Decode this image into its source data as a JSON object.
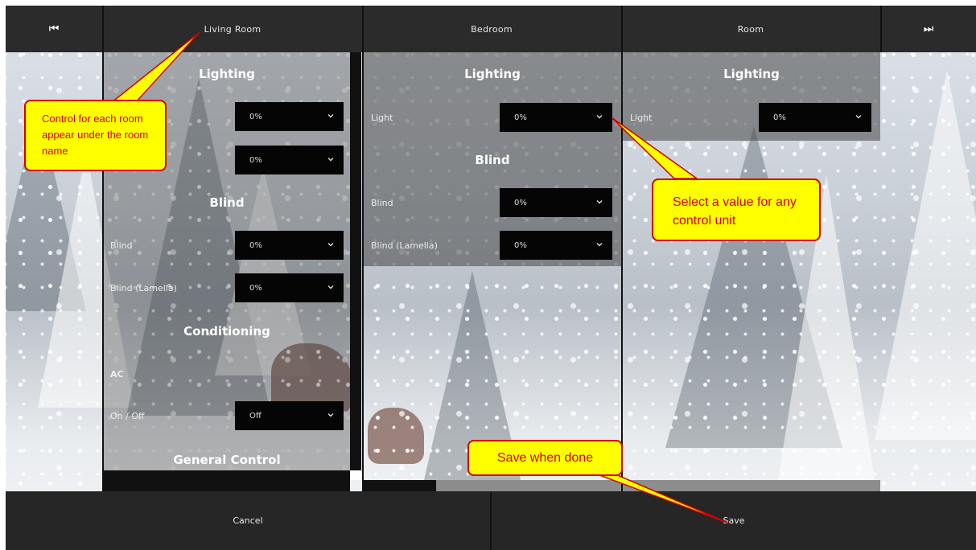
{
  "topbar": {
    "prev_icon": "skip-previous-icon",
    "next_icon": "skip-next-icon",
    "prev_glyph": "⏮",
    "next_glyph": "⏭"
  },
  "rooms": [
    {
      "name": "Living Room",
      "sections": [
        {
          "title": "Lighting"
        },
        {
          "title": "Blind"
        },
        {
          "title": "Conditioning"
        },
        {
          "title": "General Control"
        }
      ],
      "controls": [
        {
          "label": "",
          "value": "0%"
        },
        {
          "label": "",
          "value": "0%"
        },
        {
          "label": "Blind",
          "value": "0%"
        },
        {
          "label": "Blind (Lamella)",
          "value": "0%"
        },
        {
          "label": "AC",
          "value": ""
        },
        {
          "label": "On / Off",
          "value": "Off"
        }
      ]
    },
    {
      "name": "Bedroom",
      "sections": [
        {
          "title": "Lighting"
        },
        {
          "title": "Blind"
        }
      ],
      "controls": [
        {
          "label": "Light",
          "value": "0%"
        },
        {
          "label": "Blind",
          "value": "0%"
        },
        {
          "label": "Blind (Lamella)",
          "value": "0%"
        }
      ]
    },
    {
      "name": "Room",
      "sections": [
        {
          "title": "Lighting"
        }
      ],
      "controls": [
        {
          "label": "Light",
          "value": "0%"
        }
      ]
    }
  ],
  "bottombar": {
    "cancel_label": "Cancel",
    "save_label": "Save"
  },
  "callouts": {
    "room_controls": "Control for each room appear under the room name",
    "select_value": "Select a value for any control unit",
    "save_done": "Save when done"
  },
  "colors": {
    "bar": "#2b2b2b",
    "dropdown": "#050505",
    "callout_fill": "#ffff00",
    "callout_text": "#d40000"
  }
}
